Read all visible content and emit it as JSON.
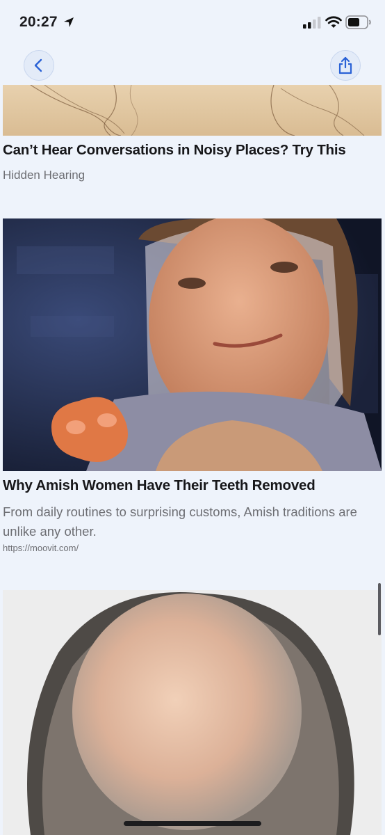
{
  "status_bar": {
    "time": "20:27",
    "icons": [
      "location-arrow-icon",
      "cellular-signal-icon",
      "wifi-icon",
      "battery-icon"
    ]
  },
  "nav": {
    "back_icon": "chevron-left-icon",
    "share_icon": "share-icon",
    "accent_color": "#2a62d6"
  },
  "articles": [
    {
      "headline": "Can’t Hear Conversations in Noisy Places? Try This",
      "source": "Hidden Hearing"
    },
    {
      "headline": "Why Amish Women Have Their Teeth Removed",
      "description": "From daily routines to surprising customs, Amish traditions are unlike any other.",
      "url": "https://moovit.com/"
    }
  ]
}
